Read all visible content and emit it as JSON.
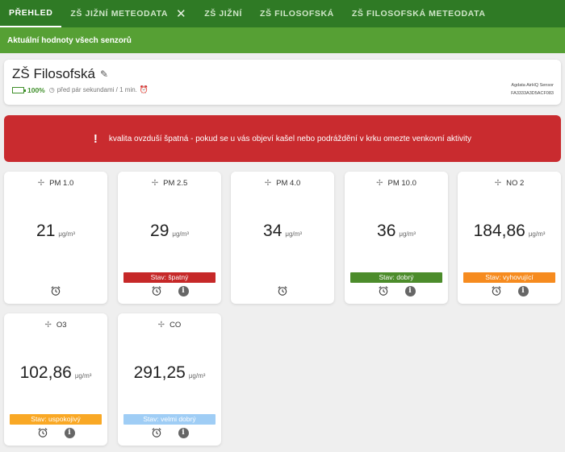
{
  "tabs": [
    {
      "label": "PŘEHLED",
      "active": true
    },
    {
      "label": "ZŠ JIŽNÍ METEODATA",
      "closable": true
    },
    {
      "label": "ZŠ JIŽNÍ"
    },
    {
      "label": "ZŠ FILOSOFSKÁ"
    },
    {
      "label": "ZŠ FILOSOFSKÁ METEODATA"
    }
  ],
  "toolbar": {
    "title": "Aktuální hodnoty všech senzorů"
  },
  "device": {
    "name": "ZŠ Filosofská",
    "battery": "100%",
    "battery_level": 1.0,
    "updated": "před pár sekundami / 1 min.",
    "model": "Agdata AirHQ Sensor",
    "serial": "FA3333A3D5ACF083"
  },
  "alert": {
    "text": "kvalita ovzduší špatná - pokud se u vás objeví kašel nebo podráždění v krku omezte venkovní aktivity"
  },
  "sensors": [
    {
      "name": "PM 1.0",
      "value": "21",
      "unit": "μg/m³"
    },
    {
      "name": "PM 2.5",
      "value": "29",
      "unit": "μg/m³",
      "status": "Stav: špatný",
      "status_color": "#c62828"
    },
    {
      "name": "PM 4.0",
      "value": "34",
      "unit": "μg/m³"
    },
    {
      "name": "PM 10.0",
      "value": "36",
      "unit": "μg/m³",
      "status": "Stav: dobrý",
      "status_color": "#4c8c2b"
    },
    {
      "name": "NO 2",
      "value": "184,86",
      "unit": "μg/m³",
      "status": "Stav: vyhovující",
      "status_color": "#f68b1f"
    },
    {
      "name": "O3",
      "value": "102,86",
      "unit": "μg/m³",
      "status": "Stav: uspokojivý",
      "status_color": "#f9a825"
    },
    {
      "name": "CO",
      "value": "291,25",
      "unit": "μg/m³",
      "status": "Stav: velmi dobrý",
      "status_color": "#9fcdf5"
    }
  ],
  "colors": {
    "tabbar": "#2f7a25",
    "toolbar": "#56a034",
    "alert": "#c92b2f"
  }
}
